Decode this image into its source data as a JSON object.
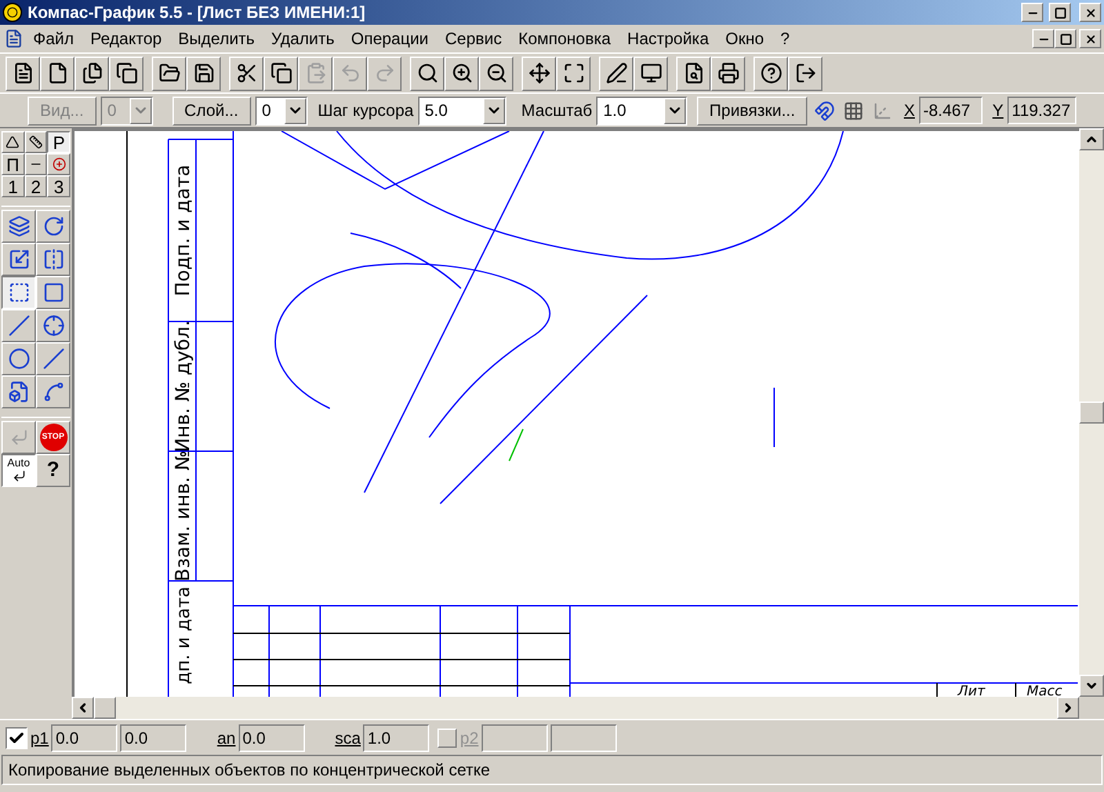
{
  "window": {
    "title": "Компас-График 5.5 - [Лист БЕЗ ИМЕНИ:1]"
  },
  "menu": [
    "Файл",
    "Редактор",
    "Выделить",
    "Удалить",
    "Операции",
    "Сервис",
    "Компоновка",
    "Настройка",
    "Окно",
    "?"
  ],
  "toolbar": [
    {
      "disabled": false
    },
    {
      "disabled": false
    },
    {
      "disabled": false
    },
    {
      "disabled": false
    },
    {
      "disabled": false
    },
    {
      "disabled": false
    },
    {
      "disabled": false
    },
    {
      "disabled": false
    },
    {
      "disabled": true
    },
    {
      "disabled": true
    },
    {
      "disabled": true
    },
    {
      "disabled": false
    },
    {
      "disabled": false
    },
    {
      "disabled": false
    },
    {
      "disabled": false
    },
    {
      "disabled": false
    },
    {
      "disabled": false
    },
    {
      "disabled": false
    },
    {
      "disabled": false
    },
    {
      "disabled": false
    },
    {
      "disabled": false
    },
    {
      "disabled": false
    }
  ],
  "state_bar": {
    "view_button": {
      "label": "Вид...",
      "disabled": true
    },
    "view_value": {
      "value": "0",
      "disabled": true
    },
    "layer_button": {
      "label": "Слой..."
    },
    "layer_value": "0",
    "step_label": "Шаг курсора",
    "step_value": "5.0",
    "scale_label": "Масштаб",
    "scale_value": "1.0",
    "snaps_button": "Привязки...",
    "x_label": "X",
    "x_value": "-8.467",
    "y_label": "Y",
    "y_value": "119.327"
  },
  "palette_modes": [
    {
      "kind": "icon",
      "selected": false
    },
    {
      "kind": "icon",
      "selected": false
    },
    {
      "kind": "text",
      "label": "Р",
      "selected": true
    },
    {
      "kind": "text",
      "label": "П",
      "selected": false
    },
    {
      "kind": "icon",
      "selected": false
    },
    {
      "kind": "icon",
      "selected": false
    },
    {
      "kind": "text",
      "label": "1",
      "selected": false
    },
    {
      "kind": "text",
      "label": "2",
      "selected": false
    },
    {
      "kind": "text",
      "label": "3",
      "selected": false
    }
  ],
  "palette_tools": [
    {
      "selected": false
    },
    {
      "selected": false
    },
    {
      "selected": false
    },
    {
      "selected": false
    },
    {
      "selected": true
    },
    {
      "selected": false
    },
    {
      "selected": false
    },
    {
      "selected": false
    },
    {
      "selected": false
    },
    {
      "selected": false
    },
    {
      "selected": false
    },
    {
      "selected": false
    }
  ],
  "palette_controls": {
    "stop_label": "STOP",
    "auto_label": "Auto",
    "help_label": "?"
  },
  "drawing": {
    "stamp_texts": [
      "Подп. и дата",
      "Инв. № дубл.",
      "Взам. инв. №",
      "дп. и дата"
    ],
    "title_block_texts": [
      "Лит",
      "Масс"
    ]
  },
  "params": {
    "p1": {
      "label": "p1",
      "checked": true,
      "values": [
        "0.0",
        "0.0"
      ]
    },
    "an": {
      "label": "an",
      "value": "0.0"
    },
    "sca": {
      "label": "sca",
      "value": "1.0"
    },
    "p2": {
      "label": "p2",
      "checked": false,
      "disabled": true
    }
  },
  "status_bar": "Копирование выделенных объектов по концентрической сетке"
}
